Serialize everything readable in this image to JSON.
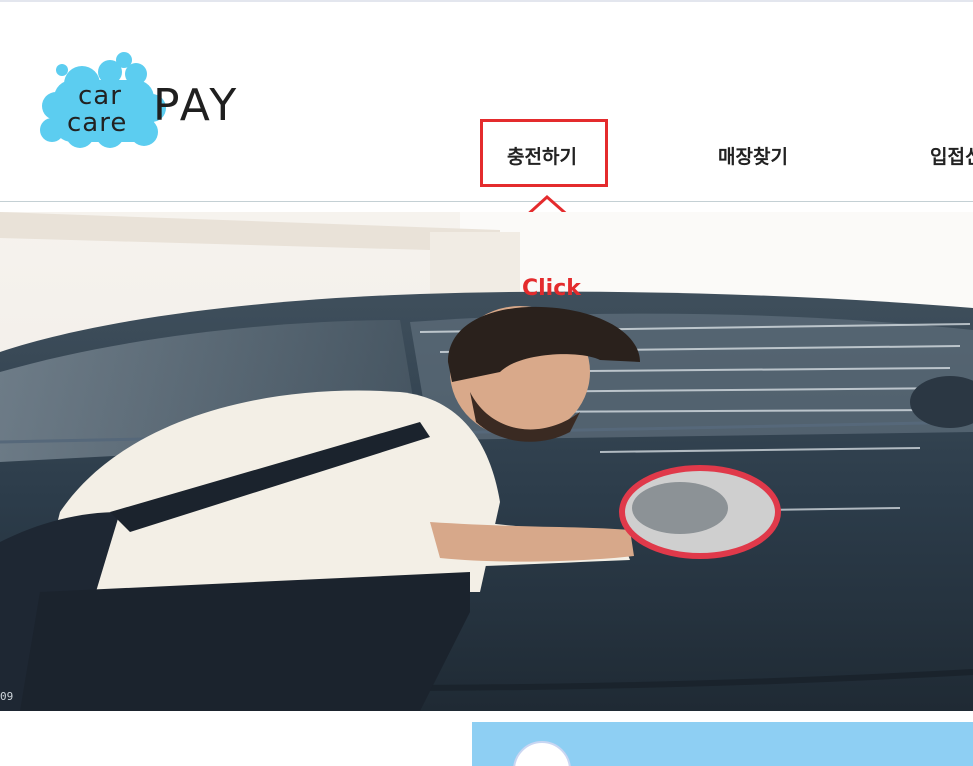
{
  "logo": {
    "line1": "car",
    "line2": "care",
    "brand": "PAY",
    "cloud_color": "#5ccdf0"
  },
  "nav": {
    "items": [
      {
        "label": "충전하기"
      },
      {
        "label": "매장찾기"
      },
      {
        "label": "입접신"
      }
    ]
  },
  "annotation": {
    "click_label": "Click",
    "color": "#e42b2d"
  },
  "hero": {
    "image": "man-washing-car-photo",
    "corner_code": "09"
  },
  "promo": {
    "background": "#8ecff3",
    "icon": "cloud-icon"
  }
}
